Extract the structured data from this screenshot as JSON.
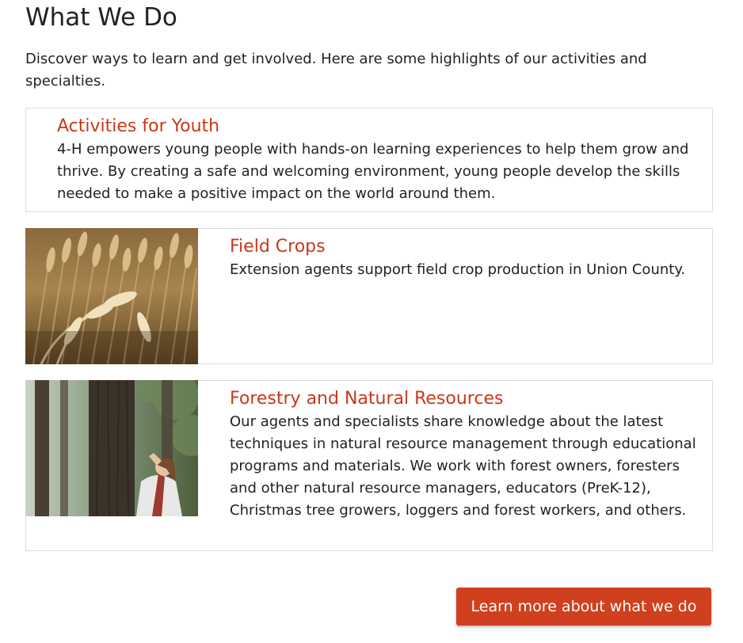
{
  "section": {
    "title": "What We Do",
    "intro": "Discover ways to learn and get involved. Here are some highlights of our activities and specialties."
  },
  "cards": [
    {
      "title": "Activities for Youth",
      "text": "4-H empowers young people with hands-on learning experiences to help them grow and thrive. By creating a safe and welcoming environment, young people develop the skills needed to make a positive impact on the world around them."
    },
    {
      "title": "Field Crops",
      "text": "Extension agents support field crop production in Union County.",
      "image": "wheat-field-photo"
    },
    {
      "title": "Forestry and Natural Resources",
      "text": "Our agents and specialists share knowledge about the latest techniques in natural resource management through educational programs and materials. We work with forest owners, foresters and other natural resource managers, educators (PreK-12), Christmas tree growers, loggers and forest workers, and others.",
      "image": "forest-woman-photo"
    }
  ],
  "cta": {
    "label": "Learn more about what we do"
  },
  "colors": {
    "accent": "#c8391a",
    "button": "#d0401e",
    "border": "#dcdcdc"
  }
}
